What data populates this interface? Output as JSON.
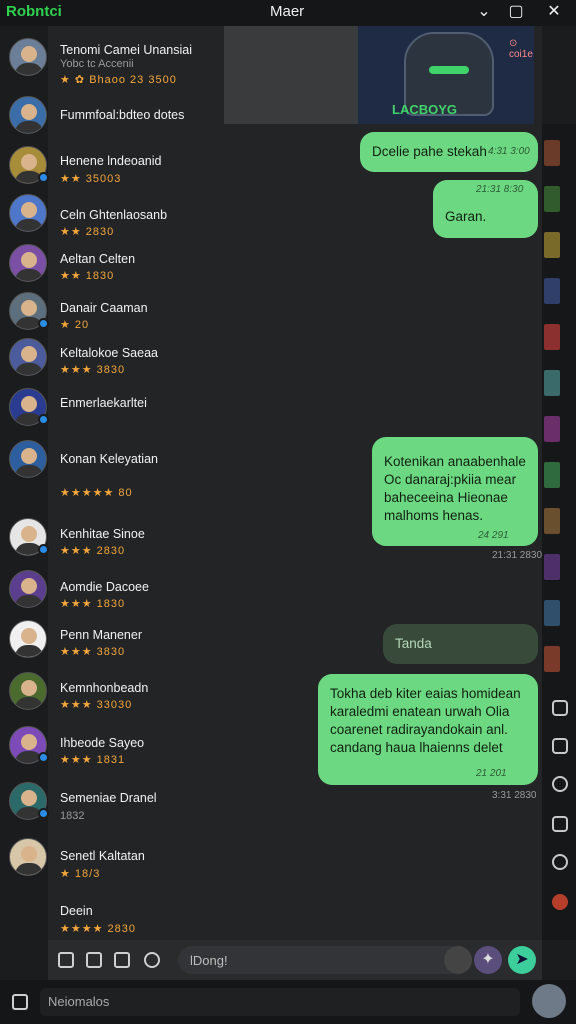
{
  "window": {
    "app_name": "Robntci",
    "title": "Maer",
    "minimize": "⌄",
    "maximize": "▢",
    "close": "✕"
  },
  "banner": {
    "text": "LACBOYG",
    "tag": "⊙ coi1e"
  },
  "contacts": [
    {
      "name": "Tenomi Camei Unansiai",
      "sub": "Yobc tc Accenii",
      "meta": "★ ✿ Bhaoo 23 3500"
    },
    {
      "name": "Fummfoal:bdteo dotes",
      "sub": "",
      "meta": ""
    },
    {
      "name": "Henene lndeoanid",
      "sub": "★★ 35003",
      "meta": ""
    },
    {
      "name": "Celn Ghtenlaosanb",
      "sub": "★★ 2830",
      "meta": ""
    },
    {
      "name": "Aeltan Celten",
      "sub": "★★ 1830",
      "meta": ""
    },
    {
      "name": "Danair Caaman",
      "sub": "★ 20",
      "meta": ""
    },
    {
      "name": "Keltalokoe Saeaa",
      "sub": "★★★ 3830",
      "meta": ""
    },
    {
      "name": "Enmerlaekarltei",
      "sub": "",
      "meta": ""
    },
    {
      "name": "Konan Keleyatian",
      "sub": "★★★★★ 80",
      "meta": ""
    },
    {
      "name": "Kenhitae Sinoe",
      "sub": "★★★ 2830",
      "meta": ""
    },
    {
      "name": "Aomdie Dacoee",
      "sub": "★★★ 1830",
      "meta": ""
    },
    {
      "name": "Penn Manener",
      "sub": "★★★ 3830",
      "meta": ""
    },
    {
      "name": "Kemnhonbeadn",
      "sub": "★★★ 33030",
      "meta": ""
    },
    {
      "name": "Ihbeode Sayeo",
      "sub": "★★★ 1831",
      "meta": ""
    },
    {
      "name": "Semeniae Dranel",
      "sub": "1832",
      "meta": ""
    },
    {
      "name": "Senetl Kaltatan",
      "sub": "★ 18/3",
      "meta": ""
    },
    {
      "name": "Deein",
      "sub": "★★★★ 2830",
      "meta": ""
    }
  ],
  "messages": [
    {
      "text": "Dcelie pahe stekah",
      "meta": "4:31 3:00"
    },
    {
      "text": "Garan.",
      "meta": "21:31 8:30"
    },
    {
      "text": "Kotenikan anaabenhale Oc danaraj:pkiia mear baheceeina Hieonae malhoms henas.",
      "meta": "24 291"
    },
    {
      "text": "Tanda",
      "meta": ""
    },
    {
      "text": "Tokha deb kiter eaias homidean karaledmi enatean urwah Olia coarenet radirayandokain anl. candang haua lhaienns delet",
      "meta": "21 201"
    }
  ],
  "outside_meta": [
    "21:31 2830",
    "3:31 2830"
  ],
  "composer": {
    "placeholder": "lDong!"
  },
  "bottom": {
    "search_placeholder": "Neiomalos"
  }
}
